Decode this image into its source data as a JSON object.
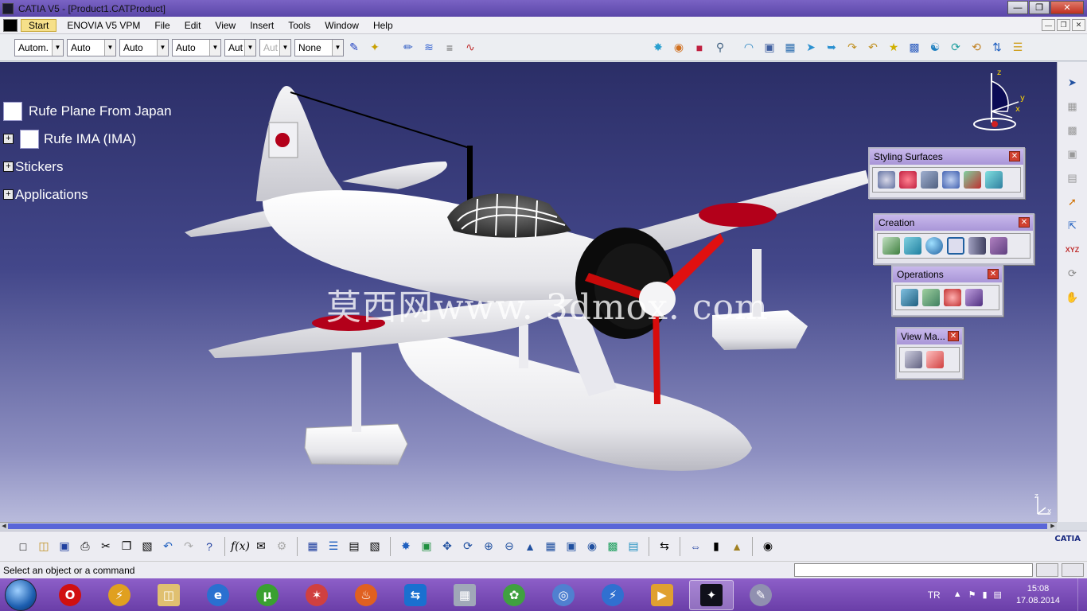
{
  "window": {
    "title": "CATIA V5 - [Product1.CATProduct]"
  },
  "menubar": {
    "items": [
      "Start",
      "ENOVIA V5 VPM",
      "File",
      "Edit",
      "View",
      "Insert",
      "Tools",
      "Window",
      "Help"
    ]
  },
  "properties": {
    "combos": [
      "Autom.",
      "Auto",
      "Auto",
      "Auto",
      "Aut",
      "Aut",
      "None"
    ]
  },
  "tree": {
    "root": "Rufe Plane From Japan",
    "children": [
      "Rufe IMA (IMA)",
      "Stickers",
      "Applications"
    ]
  },
  "watermark": "莫西网www. 3dmox. com",
  "compass": {
    "z": "z",
    "y": "y",
    "x": "x"
  },
  "floating_toolbars": {
    "styling": {
      "title": "Styling Surfaces"
    },
    "creation": {
      "title": "Creation"
    },
    "operations": {
      "title": "Operations"
    },
    "view": {
      "title": "View Ma..."
    }
  },
  "mini_axis": {
    "z": "z",
    "x": "x"
  },
  "bottom_logo": "CATIA",
  "status": {
    "message": "Select an object or a command"
  },
  "taskbar": {
    "language": "TR",
    "time": "15:08",
    "date": "17.08.2014"
  },
  "colors": {
    "accent_title": "#6a52b8",
    "viewport_top": "#2b2e67",
    "viewport_bottom": "#b9bbdc",
    "roundel": "#b3001a",
    "propeller": "#e01010"
  }
}
